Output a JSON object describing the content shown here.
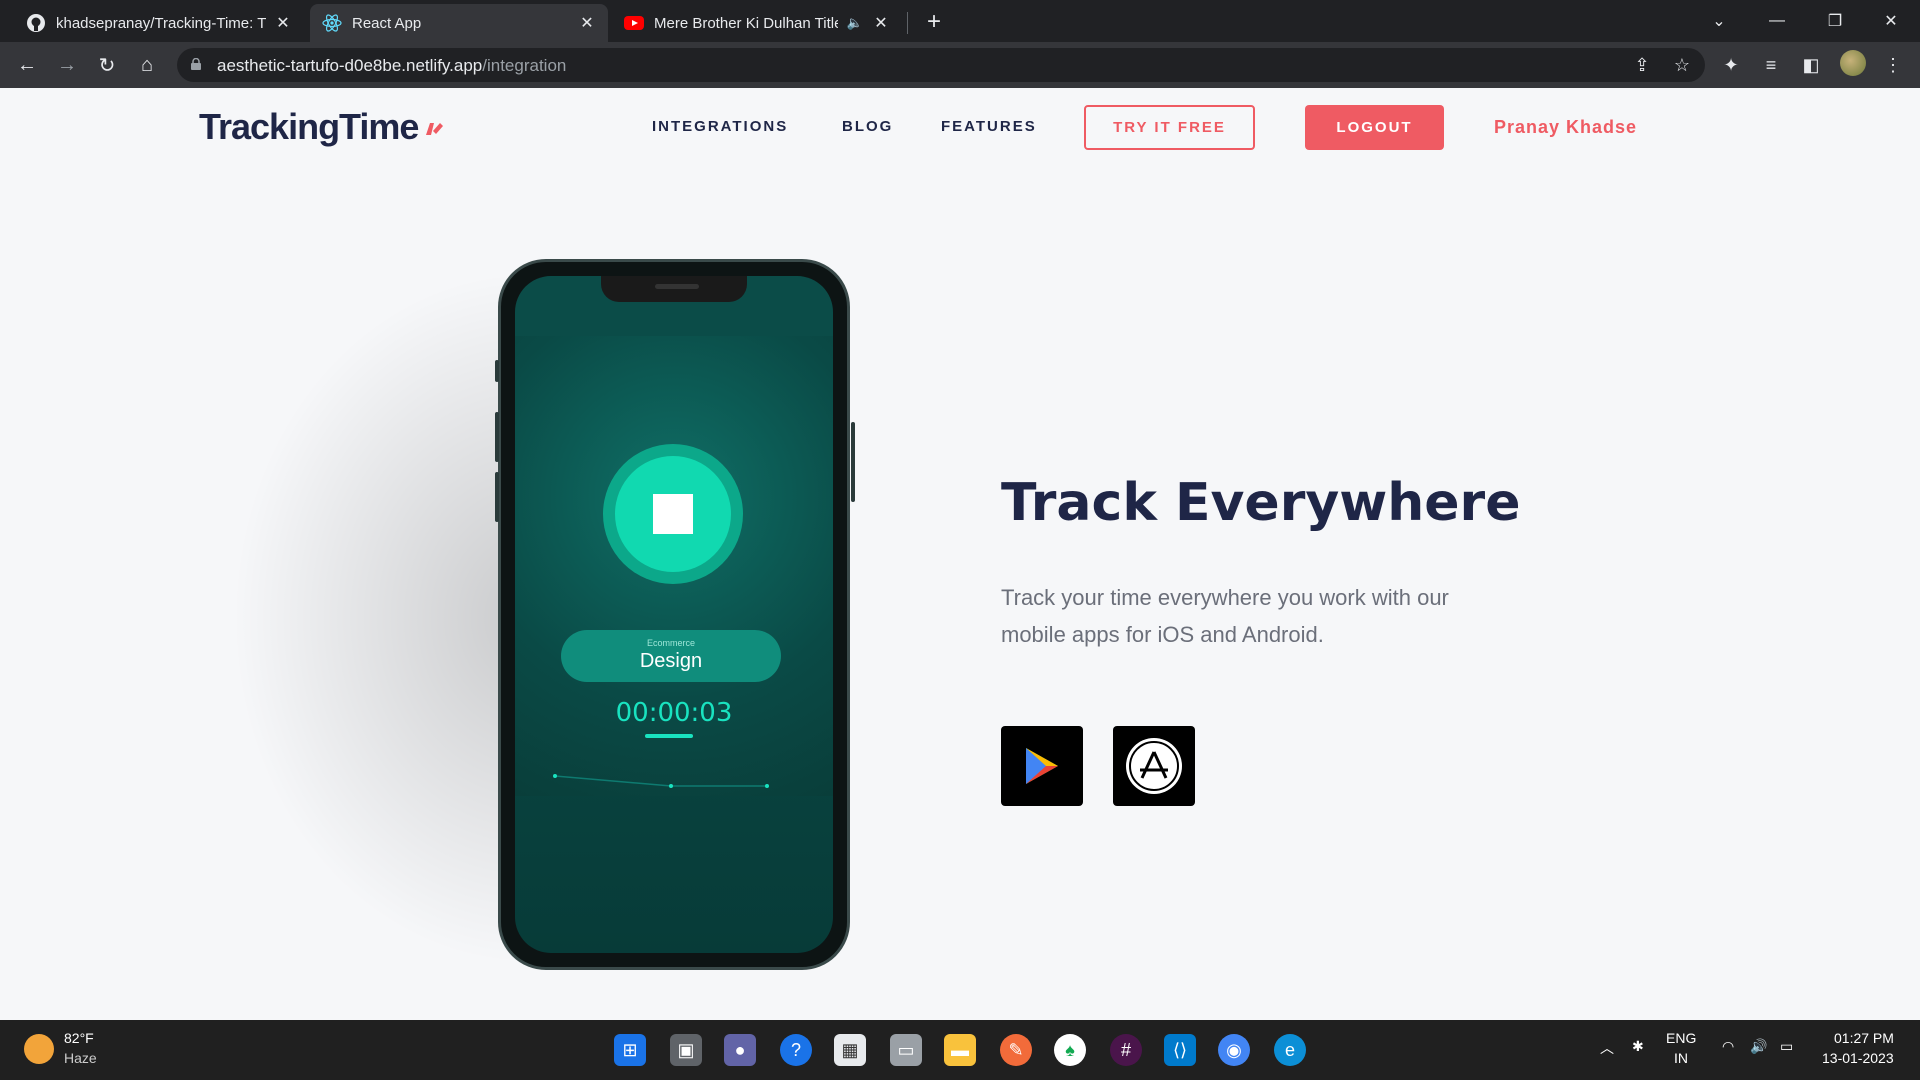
{
  "browser": {
    "tabs": [
      {
        "title": "khadsepranay/Tracking-Time: Tra",
        "icon": "github-icon"
      },
      {
        "title": "React App",
        "icon": "react-icon"
      },
      {
        "title": "Mere Brother Ki Dulhan Title",
        "icon": "youtube-icon"
      }
    ],
    "new_tab": "+",
    "url_host": "aesthetic-tartufo-d0e8be.netlify.app",
    "url_path": "/integration"
  },
  "header": {
    "logo": "TrackingTime",
    "nav": [
      "INTEGRATIONS",
      "BLOG",
      "FEATURES"
    ],
    "try_free": "TRY IT FREE",
    "logout": "LOGOUT",
    "user": "Pranay Khadse"
  },
  "phone": {
    "category": "Ecommerce",
    "task": "Design",
    "timer": "00:00:03"
  },
  "hero": {
    "title": "Track Everywhere",
    "description": "Track your time everywhere you work with our mobile apps for iOS and Android.",
    "stores": [
      "google-play-icon",
      "app-store-icon"
    ]
  },
  "taskbar": {
    "temperature": "82°F",
    "weather": "Haze",
    "lang": "ENG",
    "region": "IN",
    "time": "01:27 PM",
    "date": "13-01-2023"
  },
  "colors": {
    "accent": "#ef5b63",
    "navy": "#1f2647",
    "teal": "#11d9b0"
  }
}
